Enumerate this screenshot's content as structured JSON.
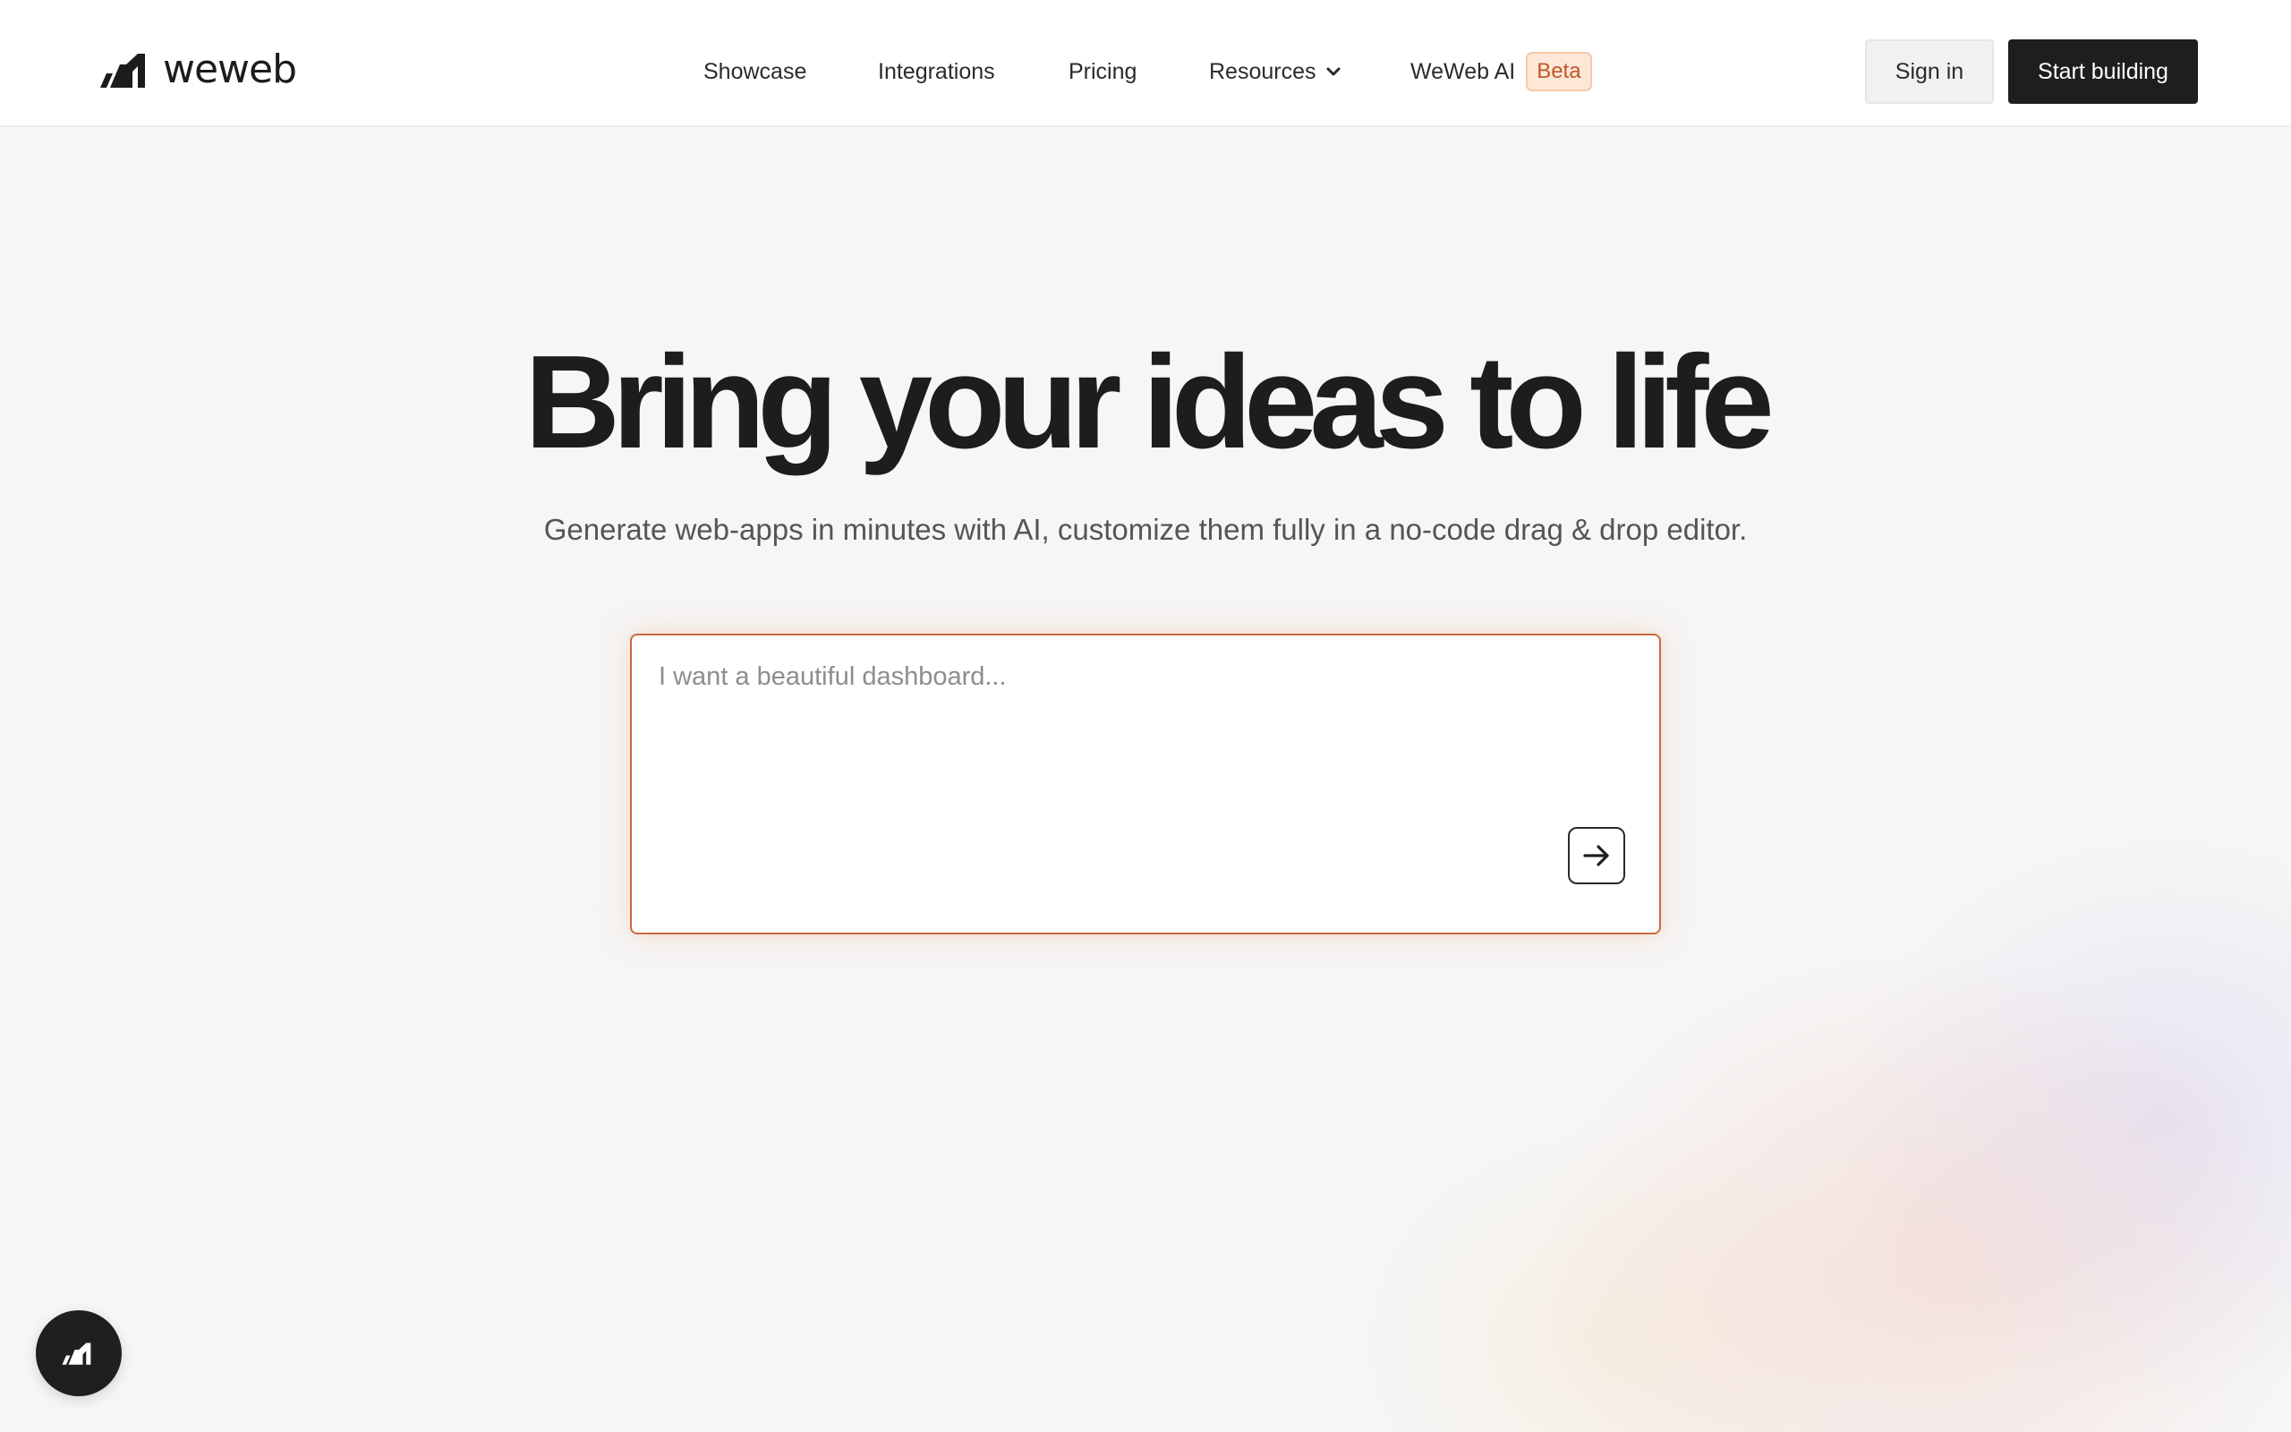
{
  "header": {
    "logo_text": "weweb",
    "nav": [
      {
        "label": "Showcase"
      },
      {
        "label": "Integrations"
      },
      {
        "label": "Pricing"
      },
      {
        "label": "Resources"
      },
      {
        "label": "WeWeb AI",
        "badge": "Beta"
      }
    ],
    "sign_in_label": "Sign in",
    "start_label": "Start building"
  },
  "hero": {
    "title": "Bring your ideas to life",
    "subtitle": "Generate web-apps in minutes with AI, customize them fully in a no-code drag & drop editor.",
    "prompt_placeholder": "I want a beautiful dashboard...",
    "prompt_value": ""
  },
  "icons": {
    "logo": "weweb-logo-icon",
    "resources_dropdown": "chevron-down-icon",
    "submit": "arrow-right-icon",
    "chat": "weweb-logo-icon"
  },
  "colors": {
    "primary_button": "#1e1e1e",
    "prompt_border": "#c86a3f",
    "beta_badge_bg": "#fde8d8",
    "beta_badge_text": "#c2572a"
  }
}
